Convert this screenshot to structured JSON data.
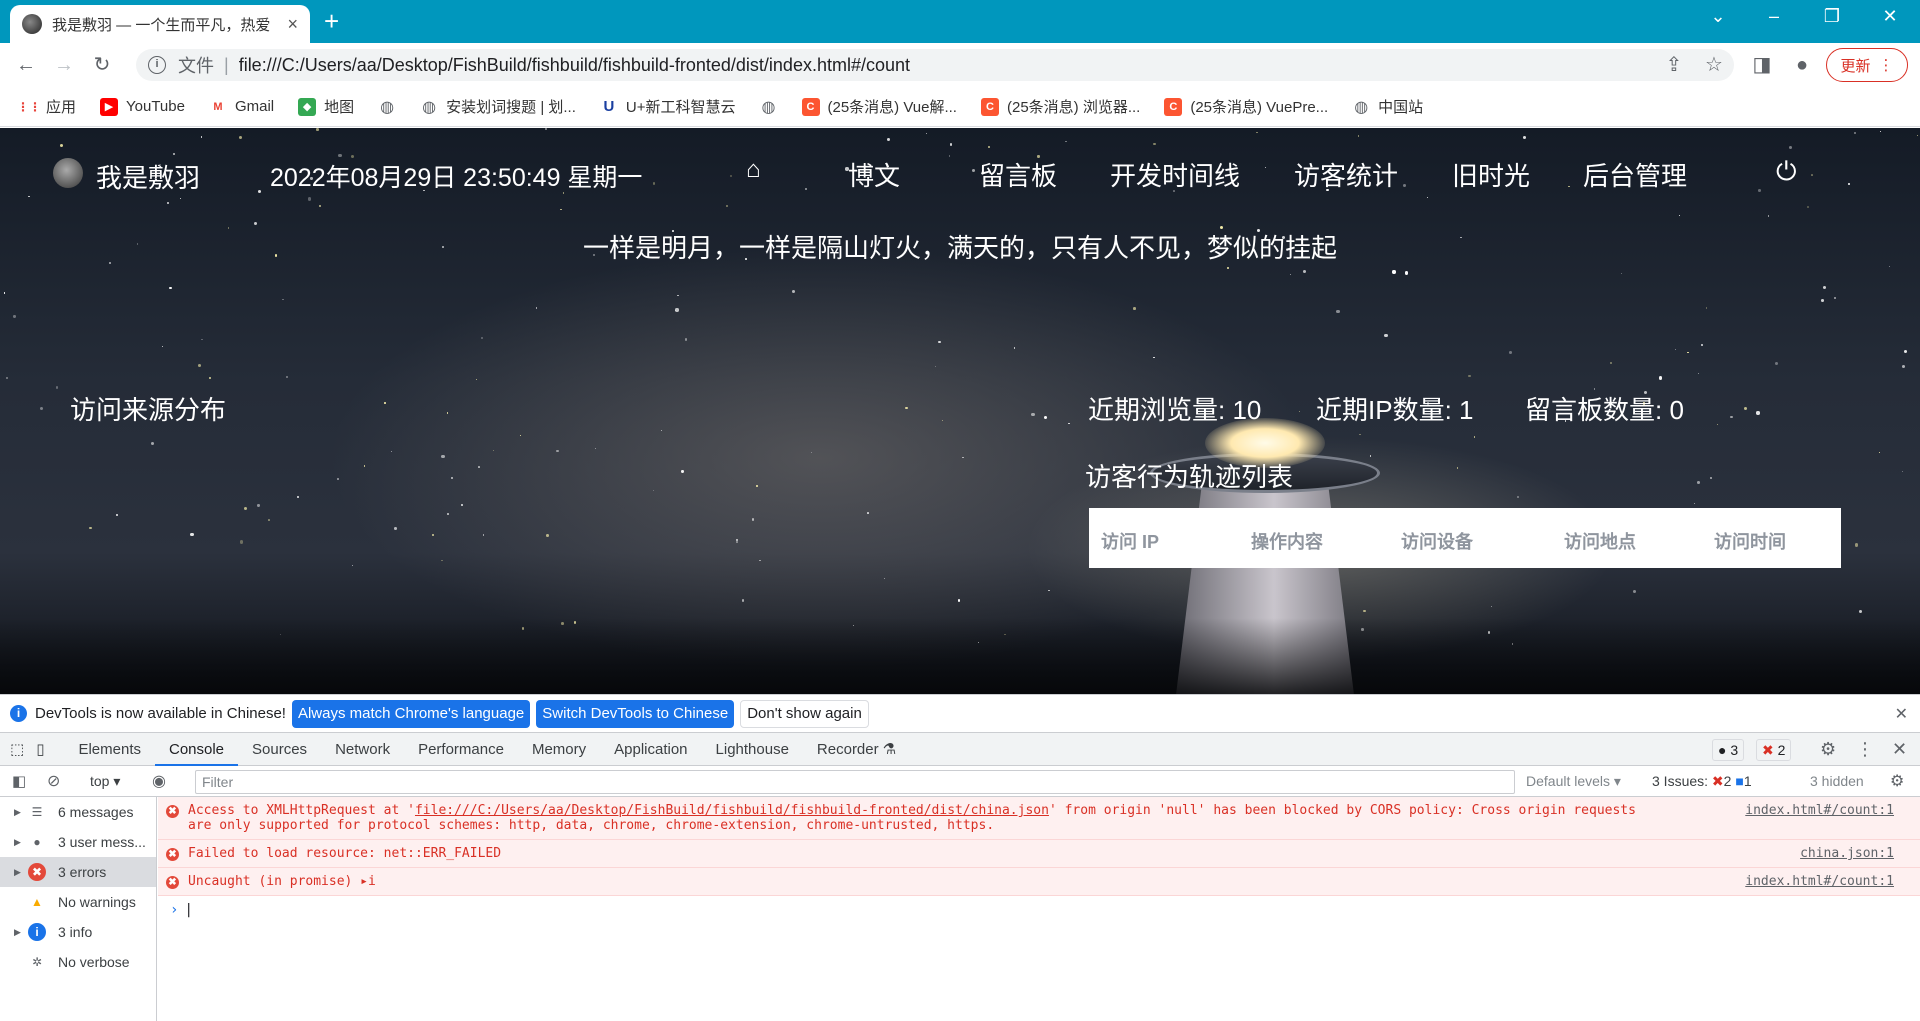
{
  "browser": {
    "tab_title": "我是敷羽 — 一个生而平凡，热爱",
    "tab_close": "×",
    "new_tab": "+",
    "window_controls": [
      "⌄",
      "–",
      "❐",
      "✕"
    ],
    "address_info": "i",
    "address_scheme_label": "文件",
    "address_separator": "|",
    "url": "file:///C:/Users/aa/Desktop/FishBuild/fishbuild/fishbuild-fronted/dist/index.html#/count",
    "update_button": "更新"
  },
  "bookmarks": [
    {
      "label": "应用",
      "icon": "apps-grid-icon"
    },
    {
      "label": "YouTube",
      "icon": "youtube-icon"
    },
    {
      "label": "Gmail",
      "icon": "gmail-icon"
    },
    {
      "label": "地图",
      "icon": "maps-icon"
    },
    {
      "label": "",
      "icon": "globe-icon"
    },
    {
      "label": "安装划词搜题 | 划...",
      "icon": "globe-icon"
    },
    {
      "label": "U+新工科智慧云",
      "icon": "uplus-icon"
    },
    {
      "label": "",
      "icon": "globe-icon"
    },
    {
      "label": "(25条消息) Vue解...",
      "icon": "csdn-icon"
    },
    {
      "label": "(25条消息) 浏览器...",
      "icon": "csdn-icon"
    },
    {
      "label": "(25条消息) VuePre...",
      "icon": "csdn-icon"
    },
    {
      "label": "中国站",
      "icon": "globe-icon"
    }
  ],
  "site": {
    "logo_text": "我是敷羽",
    "datetime": "2022年08月29日 23:50:49 星期一",
    "nav": [
      "博文",
      "留言板",
      "开发时间线",
      "访客统计",
      "旧时光",
      "后台管理"
    ],
    "quote": "一样是明月，一样是隔山灯火，满天的，只有人不见，梦似的挂起",
    "visit_source_title": "访问来源分布",
    "stats": [
      {
        "label": "近期浏览量:",
        "value": "10"
      },
      {
        "label": "近期IP数量:",
        "value": "1"
      },
      {
        "label": "留言板数量:",
        "value": "0"
      }
    ],
    "track_title": "访客行为轨迹列表",
    "track_columns": [
      "访问 IP",
      "操作内容",
      "访问设备",
      "访问地点",
      "访问时间"
    ]
  },
  "devtools": {
    "infobar_text": "DevTools is now available in Chinese!",
    "infobar_btn1": "Always match Chrome's language",
    "infobar_btn2": "Switch DevTools to Chinese",
    "infobar_btn3": "Don't show again",
    "tabs": [
      "Elements",
      "Console",
      "Sources",
      "Network",
      "Performance",
      "Memory",
      "Application",
      "Lighthouse",
      "Recorder"
    ],
    "active_tab": "Console",
    "messages_badge": "3",
    "errors_badge": "2",
    "context": "top",
    "filter_placeholder": "Filter",
    "default_levels": "Default levels",
    "issues_label": "3 Issues:",
    "issues_errors": "2",
    "issues_info": "1",
    "hidden": "3 hidden",
    "sidebar": [
      {
        "label": "6 messages",
        "icon": "list-icon",
        "sel": false
      },
      {
        "label": "3 user mess...",
        "icon": "user-icon",
        "sel": false
      },
      {
        "label": "3 errors",
        "icon": "error-icon",
        "sel": true
      },
      {
        "label": "No warnings",
        "icon": "warning-icon",
        "sel": false
      },
      {
        "label": "3 info",
        "icon": "info-icon",
        "sel": false
      },
      {
        "label": "No verbose",
        "icon": "bug-icon",
        "sel": false
      }
    ],
    "console": [
      {
        "pre": "Access to XMLHttpRequest at '",
        "link": "file:///C:/Users/aa/Desktop/FishBuild/fishbuild/fishbuild-fronted/dist/china.json",
        "post": "' from origin 'null' has been blocked by CORS policy: Cross origin requests",
        "line2": "are only supported for protocol schemes: http, data, chrome, chrome-extension, chrome-untrusted, https.",
        "src": "index.html#/count:1"
      },
      {
        "text": "Failed to load resource: net::ERR_FAILED",
        "src": "china.json:1"
      },
      {
        "text": "Uncaught (in promise) ▸i",
        "src": "index.html#/count:1"
      }
    ],
    "prompt": "›"
  }
}
